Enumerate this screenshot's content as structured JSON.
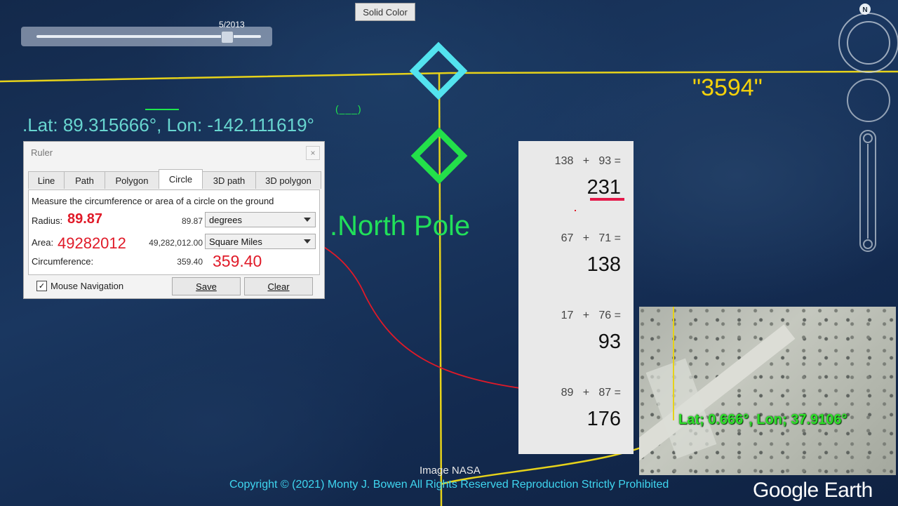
{
  "map": {
    "timeslider": {
      "date": "5/2013"
    },
    "solid_color_label": "Solid Color",
    "lat_lon_label": ".Lat:  89.315666°,  Lon: -142.111619°",
    "lon_marker": "(___)",
    "north_pole_label": ".North Pole",
    "quote_label": "\"3594\"",
    "image_credit": "Image NASA",
    "copyright": "Copyright © (2021) Monty J. Bowen All Rights Reserved Reproduction Strictly Prohibited",
    "brand": "Google Earth",
    "compass_letter": "N",
    "colors": {
      "latlon": "#68d6d0",
      "north_pole": "#21e05a",
      "quote": "#f5d20a",
      "line": "#e6d21a",
      "copyright": "#3fd6f0",
      "annotation_red": "#e01a28"
    }
  },
  "ruler": {
    "title": "Ruler",
    "close": "×",
    "tabs": [
      "Line",
      "Path",
      "Polygon",
      "Circle",
      "3D path",
      "3D polygon"
    ],
    "active_tab": "Circle",
    "description": "Measure the circumference or area of a circle on the ground",
    "radius": {
      "label": "Radius:",
      "value": "89.87",
      "unit": "degrees",
      "annotation": "89.87"
    },
    "area": {
      "label": "Area:",
      "value": "49,282,012.00",
      "unit": "Square Miles",
      "annotation": "49282012"
    },
    "circumference": {
      "label": "Circumference:",
      "value": "359.40",
      "annotation": "359.40"
    },
    "mouse_navigation": {
      "label": "Mouse Navigation",
      "checked": true,
      "check": "✓"
    },
    "save_label": "Save",
    "clear_label": "Clear"
  },
  "sums": {
    "items": [
      {
        "a": "138",
        "b": "93",
        "result": "231"
      },
      {
        "a": "67",
        "b": "71",
        "result": "138"
      },
      {
        "a": "17",
        "b": "76",
        "result": "93"
      },
      {
        "a": "89",
        "b": "87",
        "result": "176"
      }
    ],
    "plus": "+",
    "equals": "="
  },
  "inset": {
    "coords": "Lat;   0.666°, Lon;  37.9106°"
  }
}
